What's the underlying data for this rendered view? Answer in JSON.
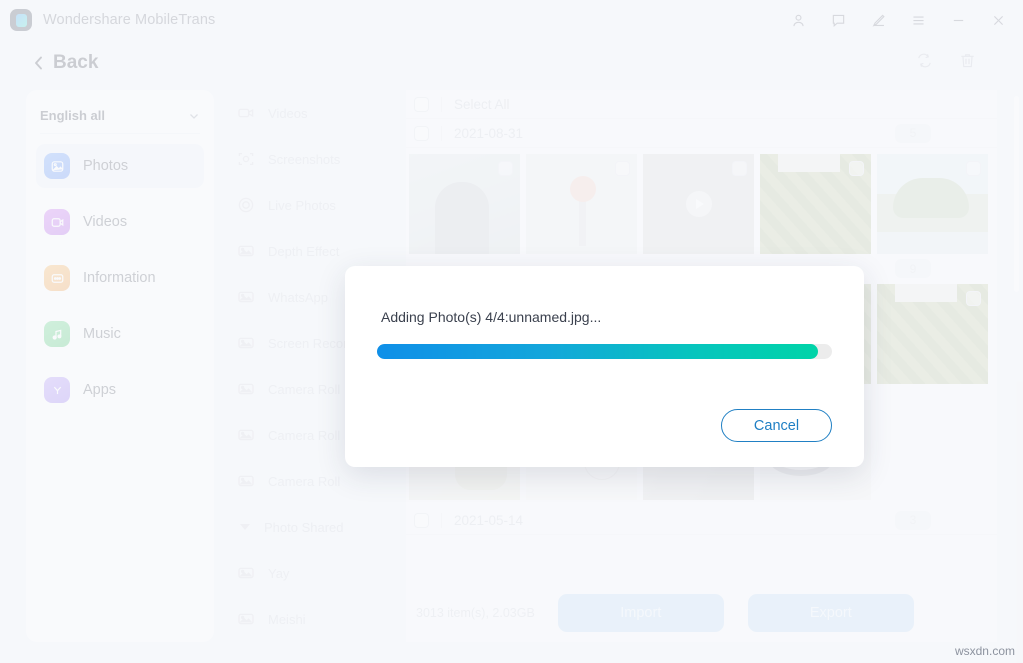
{
  "window": {
    "app_title": "Wondershare MobileTrans",
    "logo_icon": "mobiletrans-logo-icon",
    "controls": [
      {
        "name": "account-icon",
        "label": "Account"
      },
      {
        "name": "feedback-icon",
        "label": "Feedback"
      },
      {
        "name": "edit-pen-icon",
        "label": "Edit"
      },
      {
        "name": "menu-icon",
        "label": "Menu"
      },
      {
        "name": "minimize-icon",
        "label": "Minimize"
      },
      {
        "name": "close-icon",
        "label": "Close"
      }
    ]
  },
  "header": {
    "back_label": "Back",
    "back_icon": "chevron-left-icon",
    "tools": [
      {
        "name": "refresh-icon",
        "label": "Refresh"
      },
      {
        "name": "trash-icon",
        "label": "Delete"
      }
    ]
  },
  "sidebar": {
    "language_selector": {
      "value": "English all",
      "chevron": "chevron-down-icon"
    },
    "items": [
      {
        "label": "Photos",
        "icon": "photos-icon",
        "active": true
      },
      {
        "label": "Videos",
        "icon": "videos-icon",
        "active": false
      },
      {
        "label": "Information",
        "icon": "information-icon",
        "active": false
      },
      {
        "label": "Music",
        "icon": "music-icon",
        "active": false
      },
      {
        "label": "Apps",
        "icon": "apps-icon",
        "active": false
      }
    ]
  },
  "categories": [
    {
      "label": "Videos",
      "icon": "video-camera-icon",
      "type": "item"
    },
    {
      "label": "Screenshots",
      "icon": "screenshot-icon",
      "type": "item"
    },
    {
      "label": "Live Photos",
      "icon": "live-photo-icon",
      "type": "item"
    },
    {
      "label": "Depth Effect",
      "icon": "photo-icon",
      "type": "item"
    },
    {
      "label": "WhatsApp",
      "icon": "photo-icon",
      "type": "item"
    },
    {
      "label": "Screen Recorder",
      "icon": "photo-icon",
      "type": "item"
    },
    {
      "label": "Camera Roll",
      "icon": "photo-icon",
      "type": "item"
    },
    {
      "label": "Camera Roll",
      "icon": "photo-icon",
      "type": "item"
    },
    {
      "label": "Camera Roll",
      "icon": "photo-icon",
      "type": "item"
    },
    {
      "label": "Photo Shared",
      "icon": "triangle-down-icon",
      "type": "group"
    },
    {
      "label": "Yay",
      "icon": "photo-icon",
      "type": "item"
    },
    {
      "label": "Meishi",
      "icon": "photo-icon",
      "type": "item"
    }
  ],
  "content": {
    "select_all_label": "Select All",
    "groups": [
      {
        "date": "2021-08-31",
        "count": "5",
        "thumbs": [
          {
            "name": "thumb-man",
            "art": "t-man",
            "video": false
          },
          {
            "name": "thumb-flowers",
            "art": "t-flower",
            "video": false
          },
          {
            "name": "thumb-video-clip",
            "art": "t-vid",
            "video": true
          },
          {
            "name": "thumb-grass-paving",
            "art": "t-grass",
            "video": false
          },
          {
            "name": "thumb-palm-beach",
            "art": "t-palm",
            "video": false
          }
        ]
      },
      {
        "date": "",
        "count": "9",
        "thumbs": [
          {
            "name": "thumb-grass-paving-2",
            "art": "t-grass",
            "video": false
          },
          {
            "name": "thumb-grass-paving-3",
            "art": "t-grass",
            "video": false
          },
          {
            "name": "thumb-grass-paving-4",
            "art": "t-grass",
            "video": false
          },
          {
            "name": "thumb-grass-paving-5",
            "art": "t-grass",
            "video": false
          },
          {
            "name": "thumb-grass-paving-6",
            "art": "t-grass",
            "video": false
          }
        ]
      },
      {
        "date": "",
        "count": "",
        "thumbs": [
          {
            "name": "thumb-artwork",
            "art": "t-art",
            "video": false
          },
          {
            "name": "thumb-infographic",
            "art": "t-charts",
            "video": false
          },
          {
            "name": "thumb-room-video",
            "art": "t-room",
            "video": true
          },
          {
            "name": "thumb-cable",
            "art": "t-cable",
            "video": false
          }
        ]
      }
    ],
    "last_date_row": {
      "date": "2021-05-14",
      "count": "3"
    }
  },
  "footer": {
    "totals": "3013 item(s), 2.03GB",
    "import_label": "Import",
    "export_label": "Export"
  },
  "modal": {
    "message": "Adding Photo(s) 4/4:unnamed.jpg...",
    "progress_percent": 97,
    "cancel_label": "Cancel",
    "gradient_start": "#0f8fe8",
    "gradient_end": "#00d4a8"
  },
  "watermark": "wsxdn.com"
}
